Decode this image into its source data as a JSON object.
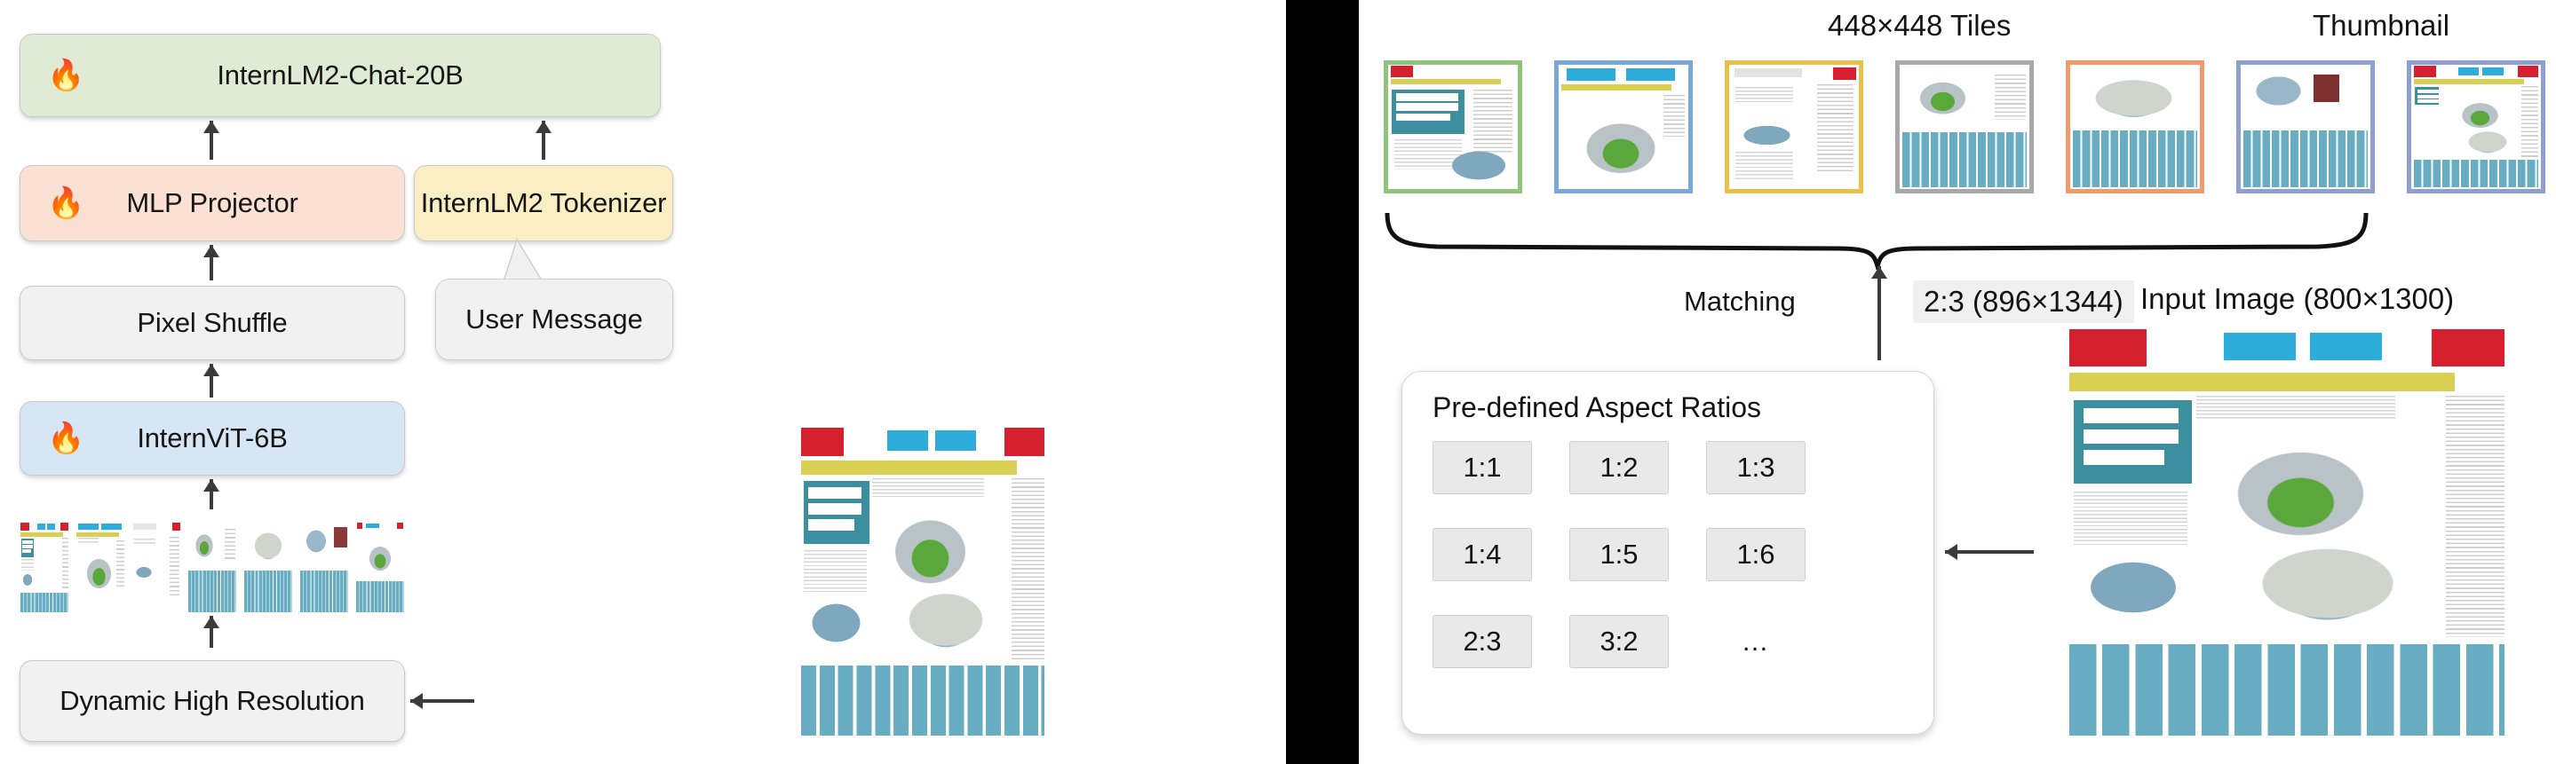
{
  "left_panel": {
    "blocks": [
      {
        "id": "llm",
        "label": "InternLM2-Chat-20B",
        "icon": "fire-icon",
        "color": "#dfebd4",
        "trainable": true
      },
      {
        "id": "mlp",
        "label": "MLP Projector",
        "icon": "fire-icon",
        "color": "#fae1d3",
        "trainable": true
      },
      {
        "id": "pixel_shuffle",
        "label": "Pixel Shuffle",
        "color": "#f1f1f1",
        "trainable": false
      },
      {
        "id": "vit",
        "label": "InternViT-6B",
        "icon": "fire-icon",
        "color": "#d7e6f4",
        "trainable": true
      },
      {
        "id": "dhr",
        "label": "Dynamic High Resolution",
        "color": "#f1f1f1",
        "trainable": false
      }
    ],
    "tokenizer": {
      "label": "InternLM2 Tokenizer",
      "color": "#fbeec5"
    },
    "user_message": {
      "label": "User Message",
      "color": "#f1f1f1"
    },
    "tile_strip_count": 7,
    "input_image_name": "newspaper-infographic"
  },
  "right_panel": {
    "tiles_heading": "448×448 Tiles",
    "thumbnail_heading": "Thumbnail",
    "matching_label": "Matching",
    "matched_ratio_badge": "2:3 (896×1344)",
    "input_image_heading": "Input Image (800×1300)",
    "aspect_card": {
      "title": "Pre-defined Aspect Ratios",
      "ratios": [
        "1:1",
        "1:2",
        "1:3",
        "1:4",
        "1:5",
        "1:6",
        "2:3",
        "3:2",
        "…"
      ]
    },
    "tile_border_colors": [
      "#8fc47a",
      "#7ba7d4",
      "#e9c04a",
      "#a8a8a8",
      "#ef9b6e",
      "#8f9fd0"
    ],
    "thumbnail_border_color": "#8f9fd0"
  },
  "icons": {
    "fire": "🔥"
  },
  "colors": {
    "divider": "#000000",
    "arrow": "#3b3b3b",
    "box_border": "#c9c9c9",
    "badge_bg": "#f0f0f0"
  }
}
